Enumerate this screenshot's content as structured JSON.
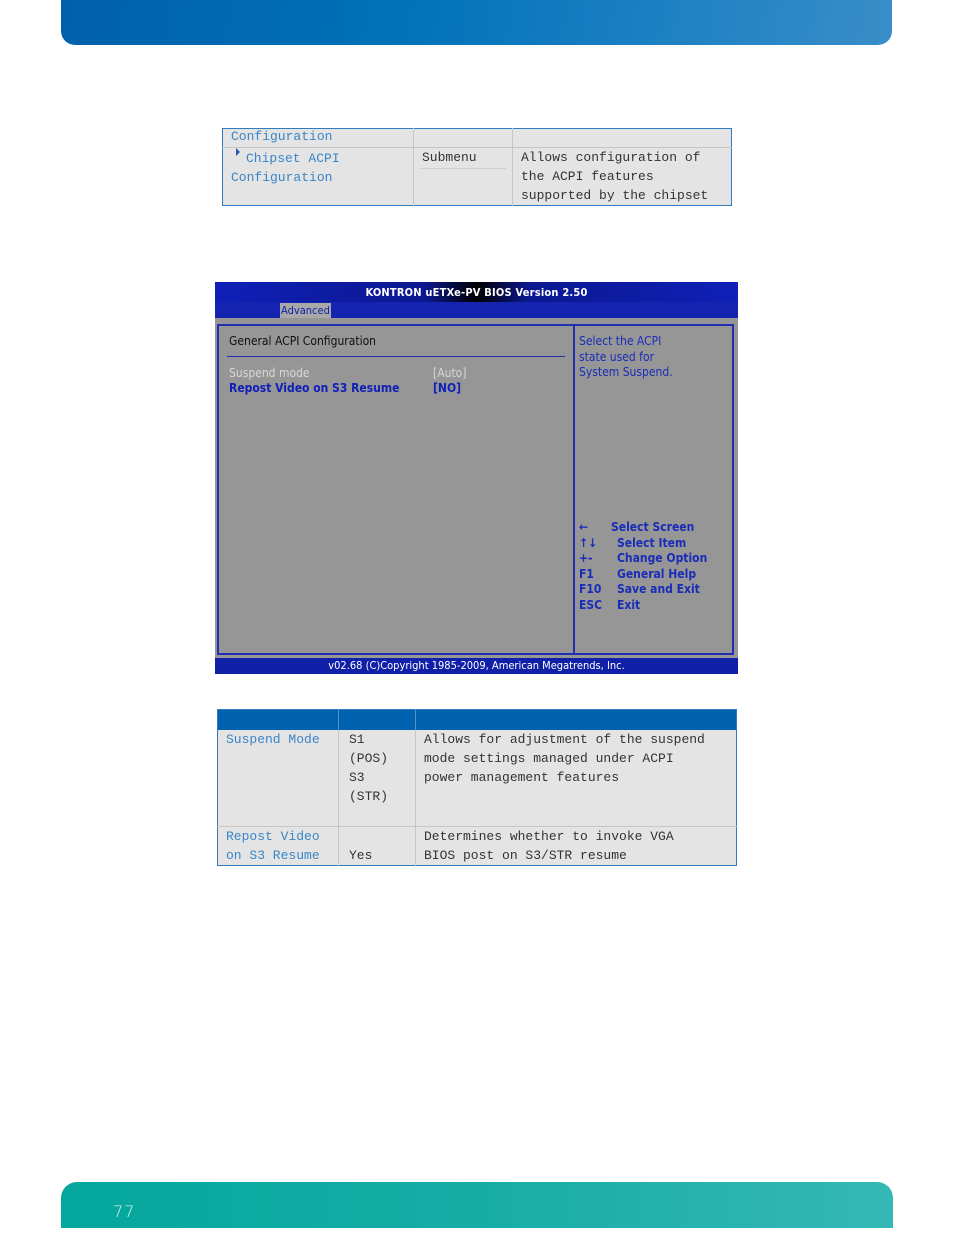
{
  "page": {
    "number": "77"
  },
  "colors": {
    "header_blue": "#0060ac",
    "footer_teal": "#04a79c",
    "bios_blue": "#1020a8",
    "bios_gray": "#969696",
    "link_blue": "#3a85c7"
  },
  "table_top": {
    "header": [
      "Configuration",
      "",
      ""
    ],
    "rows": [
      {
        "feature_lines": [
          "Chipset ACPI",
          "Configuration"
        ],
        "icon": "submenu-arrow-icon",
        "options": "Submenu",
        "description_lines": [
          "Allows configuration of",
          "the ACPI features",
          "supported by the chipset"
        ]
      }
    ]
  },
  "bios": {
    "title": "KONTRON uETXe-PV BIOS Version 2.50",
    "active_tab": "Advanced",
    "section_title": "General ACPI Configuration",
    "items": [
      {
        "label": "Suspend mode",
        "value": "[Auto]"
      },
      {
        "label": "Repost Video on S3 Resume",
        "value": "[NO]"
      }
    ],
    "help_lines": [
      "Select the ACPI",
      "state used for",
      "System Suspend."
    ],
    "keys": [
      {
        "key": "←",
        "action": "Select Screen"
      },
      {
        "key": "↑↓",
        "action": "Select Item"
      },
      {
        "key": "+-",
        "action": "Change Option"
      },
      {
        "key": "F1",
        "action": "General Help"
      },
      {
        "key": "F10",
        "action": "Save and Exit"
      },
      {
        "key": "ESC",
        "action": "Exit"
      }
    ],
    "status": "v02.68 (C)Copyright 1985-2009, American Megatrends, Inc."
  },
  "table_bottom": {
    "header": [
      "",
      "",
      ""
    ],
    "rows": [
      {
        "feature_lines": [
          "Suspend Mode"
        ],
        "option_lines": [
          "S1",
          "(POS)",
          "S3",
          "(STR)"
        ],
        "description_lines": [
          "Allows for adjustment of the suspend",
          "mode settings managed under ACPI",
          "power management features"
        ]
      },
      {
        "feature_lines": [
          "Repost Video",
          "on S3 Resume"
        ],
        "option_lines": [
          "",
          "Yes"
        ],
        "description_lines": [
          "Determines whether to invoke VGA",
          "BIOS post on S3/STR resume"
        ]
      }
    ]
  }
}
